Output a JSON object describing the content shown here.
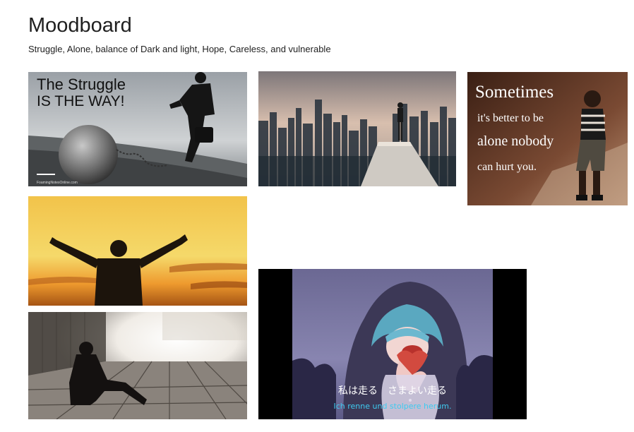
{
  "page": {
    "title": "Moodboard",
    "subtitle": "Struggle, Alone, balance of Dark and light, Hope, Careless, and vulnerable"
  },
  "images": {
    "struggle": {
      "line1": "The Struggle",
      "line2": "IS THE WAY!",
      "credit": "FoamingNotesOnline.com"
    },
    "city": {},
    "sometimes": {
      "line1": "Sometimes",
      "line2": "it's better to be",
      "line3": "alone nobody",
      "line4": "can hurt you."
    },
    "hope": {},
    "alone": {},
    "anime": {
      "jp_caption": "私は走る　さまよい走る",
      "de_caption": "Ich renne und stolpere herum."
    }
  }
}
